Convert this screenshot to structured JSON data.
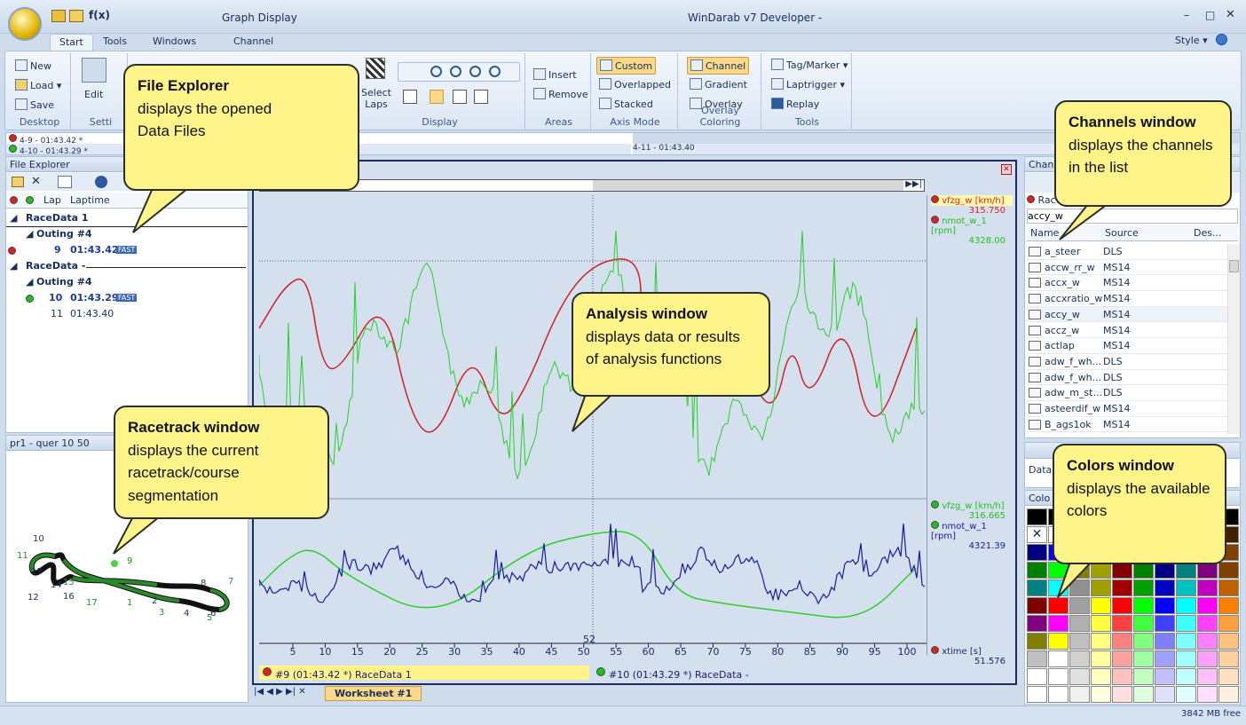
{
  "app": {
    "title": "WinDarab v7 Developer -",
    "doc_title": "Graph Display",
    "qa_label": "f(x)",
    "style_label": "Style"
  },
  "tabs": [
    "Start",
    "Tools",
    "Windows",
    "Channel"
  ],
  "ribbon": {
    "desktop": {
      "label": "Desktop",
      "new": "New",
      "load": "Load",
      "save": "Save"
    },
    "settings": {
      "label": "Setti",
      "edit": "Edit"
    },
    "display": {
      "label": "Display",
      "select_laps": "Select Laps"
    },
    "areas": {
      "label": "Areas",
      "insert": "Insert",
      "remove": "Remove"
    },
    "axis_mode": {
      "label": "Axis Mode",
      "custom": "Custom",
      "overlapped": "Overlapped",
      "stacked": "Stacked"
    },
    "overlay_coloring": {
      "label": "Overlay Coloring",
      "channel": "Channel",
      "gradient": "Gradient",
      "overlay": "Overlay"
    },
    "tools": {
      "label": "Tools",
      "tag_marker": "Tag/Marker",
      "laptrigger": "Laptrigger",
      "replay": "Replay"
    }
  },
  "laps_bar": {
    "row1": "4-9 - 01:43.42 *",
    "row2": "4-10 - 01:43.29 *",
    "row2_right": "4-11 - 01:43.40"
  },
  "file_explorer": {
    "title": "File Explorer",
    "col_lap": "Lap",
    "col_laptime": "Laptime",
    "items": [
      {
        "text": "RaceData 1",
        "level": 0,
        "kind": "group"
      },
      {
        "text": "Outing #4",
        "level": 1,
        "kind": "outing"
      },
      {
        "lap": "9",
        "time": "01:43.42",
        "badge": "FAST",
        "dot": "red",
        "bold": true
      },
      {
        "text": "RaceData -",
        "level": 0,
        "kind": "group"
      },
      {
        "text": "Outing #4",
        "level": 1,
        "kind": "outing"
      },
      {
        "lap": "10",
        "time": "01:43.29",
        "badge": "FAST",
        "dot": "green",
        "bold": true
      },
      {
        "lap": "11",
        "time": "01:43.40",
        "badge": "",
        "dot": "",
        "bold": false
      }
    ]
  },
  "racetrack": {
    "title": "pr1 - quer 10 50",
    "segments": [
      "10",
      "11",
      "9",
      "8",
      "7",
      "13",
      "14",
      "15",
      "16",
      "12",
      "17",
      "1",
      "2",
      "3",
      "4",
      "6",
      "5"
    ]
  },
  "analysis": {
    "upper_legend": [
      {
        "name": "vfzg_w [km/h]",
        "value": "315.750",
        "color": "#e02020"
      },
      {
        "name": "nmot_w_1 [rpm]",
        "value": "4328.00",
        "color": "#20c020"
      }
    ],
    "lower_legend": [
      {
        "name": "vfzg_w [km/h]",
        "value": "316.665",
        "color": "#20c020"
      },
      {
        "name": "nmot_w_1 [rpm]",
        "value": "4321.39",
        "color": "#1a1aa0"
      }
    ],
    "xaxis": {
      "label": "xtime [s]",
      "value": "51.576",
      "cursor": "52",
      "ticks": [
        "5",
        "10",
        "15",
        "20",
        "25",
        "30",
        "35",
        "40",
        "45",
        "50",
        "55",
        "60",
        "65",
        "70",
        "75",
        "80",
        "85",
        "90",
        "95",
        "100"
      ]
    },
    "lap1": "#9 (01:43.42 *) RaceData 1",
    "lap2": "#10 (01:43.29 *) RaceData -",
    "worksheet": "Worksheet #1"
  },
  "channels": {
    "title": "Chann",
    "race": "Race",
    "search": "accy_w",
    "cols": [
      "Name",
      "Source",
      "Des..."
    ],
    "rows": [
      [
        "a_steer",
        "DLS"
      ],
      [
        "accw_rr_w",
        "MS14"
      ],
      [
        "accx_w",
        "MS14"
      ],
      [
        "accxratio_w",
        "MS14"
      ],
      [
        "accy_w",
        "MS14"
      ],
      [
        "accz_w",
        "MS14"
      ],
      [
        "actlap",
        "MS14"
      ],
      [
        "adw_f_wh...",
        "DLS"
      ],
      [
        "adw_f_wh...",
        "DLS"
      ],
      [
        "adw_m_st...",
        "DLS"
      ],
      [
        "asteerdif_w",
        "MS14"
      ],
      [
        "B_ags1ok",
        "MS14"
      ]
    ]
  },
  "colors": {
    "title": "Colo",
    "data_label": "Data s"
  },
  "status": {
    "memory": "3842 MB free"
  },
  "callouts": {
    "file_explorer": {
      "title": "File Explorer",
      "text": "displays the opened Data Files"
    },
    "analysis": {
      "title": "Analysis window",
      "text": "displays data or results of analysis functions"
    },
    "racetrack": {
      "title": "Racetrack window",
      "text": "displays the current racetrack/course segmentation"
    },
    "channels": {
      "title": "Channels window",
      "text": "displays the channels in the list"
    },
    "colors": {
      "title": "Colors window",
      "text": "displays the available colors"
    }
  }
}
